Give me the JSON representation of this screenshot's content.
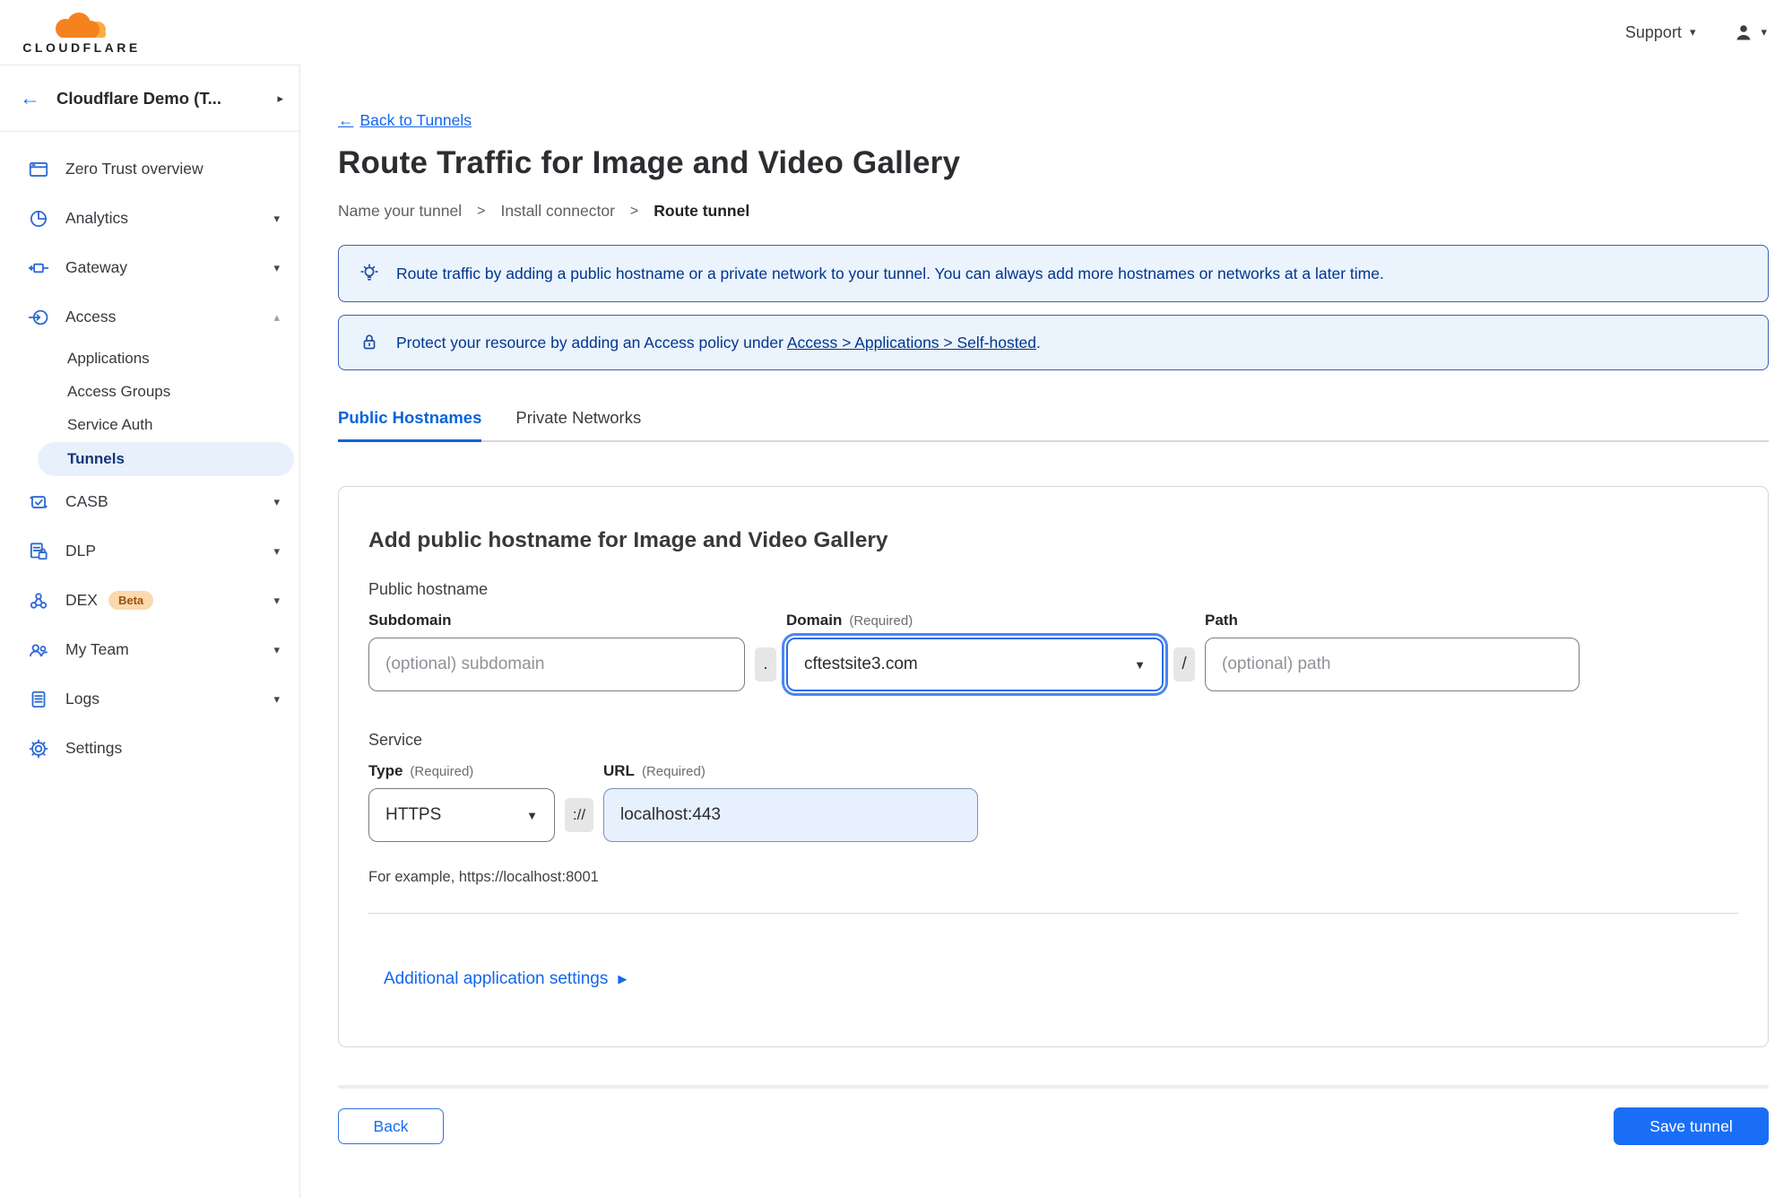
{
  "colors": {
    "accent_blue": "#1a6ef5",
    "link_blue": "#1466ee",
    "active_tab_blue": "#0b63d9",
    "banner_bg": "#ebf3fd",
    "banner_border": "#3a5fb4",
    "banner_text": "#00368c",
    "sidebar_icon_blue": "#2e6bd3",
    "selected_pill_bg": "#e8f1fb",
    "selected_pill_text": "#16337c",
    "beta_badge_bg": "#fbd8ae",
    "beta_badge_text": "#97530f",
    "brand_orange": "#f6821f",
    "brand_orange_light": "#fbad41",
    "url_filled_bg": "#e7f0fd"
  },
  "icons": {
    "back_arrow": "←",
    "chevron_right": "▸",
    "caret_down": "▾",
    "caret_up": "▴",
    "select_caret": "▼",
    "play_arrow": "▶",
    "step_sep": ">"
  },
  "topbar": {
    "brand": "CLOUDFLARE",
    "support": "Support"
  },
  "sidebar": {
    "account": "Cloudflare Demo (T...",
    "items": [
      {
        "label": "Zero Trust overview"
      },
      {
        "label": "Analytics"
      },
      {
        "label": "Gateway"
      },
      {
        "label": "Access"
      },
      {
        "label": "CASB"
      },
      {
        "label": "DLP"
      },
      {
        "label": "DEX",
        "badge": "Beta"
      },
      {
        "label": "My Team"
      },
      {
        "label": "Logs"
      },
      {
        "label": "Settings"
      }
    ],
    "access_children": [
      {
        "label": "Applications"
      },
      {
        "label": "Access Groups"
      },
      {
        "label": "Service Auth"
      },
      {
        "label": "Tunnels"
      }
    ]
  },
  "page": {
    "back_text": "Back to Tunnels",
    "title": "Route Traffic for Image and Video Gallery",
    "steps": [
      "Name your tunnel",
      "Install connector",
      "Route tunnel"
    ]
  },
  "banners": {
    "tip": "Route traffic by adding a public hostname or a private network to your tunnel. You can always add more hostnames or networks at a later time.",
    "protect_prefix": "Protect your resource by adding an Access policy under ",
    "protect_link": "Access > Applications > Self-hosted",
    "protect_suffix": "."
  },
  "tabs": [
    {
      "label": "Public Hostnames"
    },
    {
      "label": "Private Networks"
    }
  ],
  "form": {
    "heading": "Add public hostname for Image and Video Gallery",
    "section_hostname": "Public hostname",
    "subdomain_label": "Subdomain",
    "subdomain_placeholder": "(optional) subdomain",
    "dot_sep": ".",
    "domain_label": "Domain",
    "required": "(Required)",
    "domain_value": "cftestsite3.com",
    "slash_sep": "/",
    "path_label": "Path",
    "path_placeholder": "(optional) path",
    "section_service": "Service",
    "type_label": "Type",
    "type_value": "HTTPS",
    "scheme_sep": "://",
    "url_label": "URL",
    "url_value": "localhost:443",
    "example": "For example, https://localhost:8001",
    "additional_settings": "Additional application settings"
  },
  "footer": {
    "back": "Back",
    "save": "Save tunnel"
  }
}
